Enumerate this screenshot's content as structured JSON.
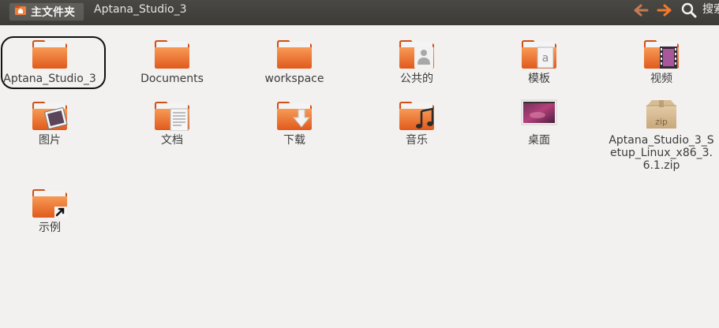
{
  "toolbar": {
    "home_label": "主文件夹",
    "current_label": "Aptana_Studio_3",
    "back_icon": "arrow-left-icon",
    "forward_icon": "arrow-right-icon",
    "search_icon": "magnifier-icon",
    "search_label": "搜索",
    "arrow_color": "#e8642a"
  },
  "items": [
    {
      "label": "Aptana_Studio_3",
      "icon": "folder-icon"
    },
    {
      "label": "Documents",
      "icon": "folder-icon"
    },
    {
      "label": "workspace",
      "icon": "folder-icon"
    },
    {
      "label": "公共的",
      "icon": "folder-public-icon"
    },
    {
      "label": "模板",
      "icon": "folder-templates-icon"
    },
    {
      "label": "视频",
      "icon": "folder-videos-icon"
    },
    {
      "label": "图片",
      "icon": "folder-pictures-icon"
    },
    {
      "label": "文档",
      "icon": "folder-documents-icon"
    },
    {
      "label": "下载",
      "icon": "folder-downloads-icon"
    },
    {
      "label": "音乐",
      "icon": "folder-music-icon"
    },
    {
      "label": "桌面",
      "icon": "desktop-icon"
    },
    {
      "label": "Aptana_Studio_3_Setup_Linux_x86_3.6.1.zip",
      "icon": "zip-archive-icon",
      "badge": "zip"
    },
    {
      "label": "示例",
      "icon": "folder-link-icon"
    }
  ],
  "colors": {
    "folder_orange": "#f07e3c",
    "folder_dark": "#cf4f16",
    "toolbar_bg": "#3c3b37",
    "window_bg": "#f2f1f0",
    "selection_ring": "#111111"
  }
}
